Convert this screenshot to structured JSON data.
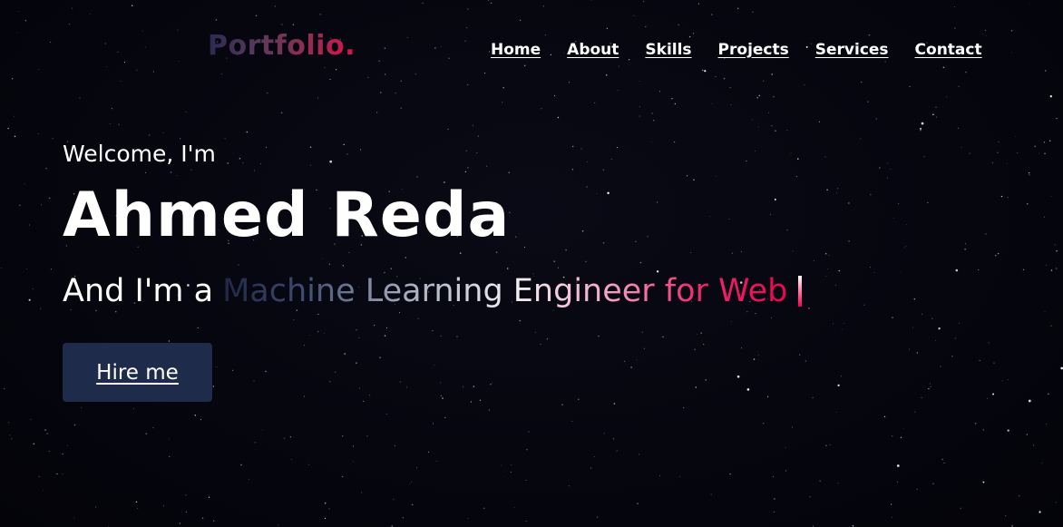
{
  "logo": {
    "text": "Portfolio."
  },
  "nav": {
    "items": [
      {
        "label": "Home"
      },
      {
        "label": "About"
      },
      {
        "label": "Skills"
      },
      {
        "label": "Projects"
      },
      {
        "label": "Services"
      },
      {
        "label": "Contact"
      }
    ]
  },
  "hero": {
    "greeting": "Welcome, I'm",
    "name": "Ahmed Reda",
    "role_prefix": "And I'm a",
    "role": "Machine Learning Engineer for Web",
    "cta_label": "Hire me"
  },
  "colors": {
    "background": "#05050d",
    "button": "#1e2b4a",
    "accent": "#e8064f",
    "text": "#ffffff"
  }
}
